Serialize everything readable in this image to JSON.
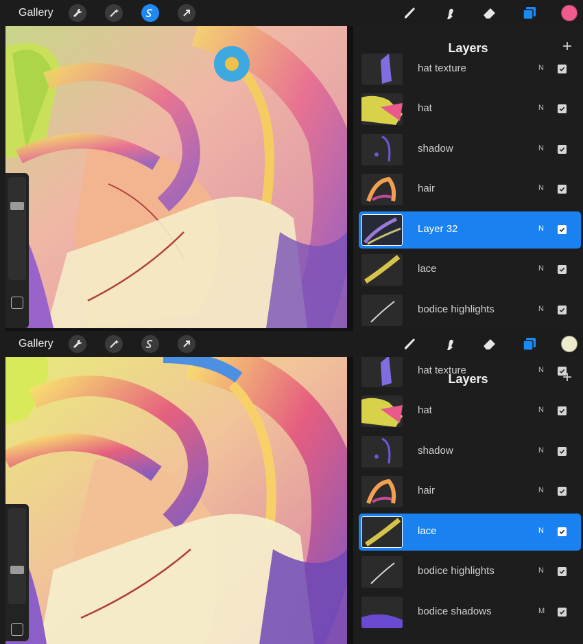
{
  "screens": [
    {
      "toolbar": {
        "gallery_label": "Gallery",
        "active_tool": "smudge",
        "color": "#ef5b8c"
      },
      "panel": {
        "title": "Layers",
        "add_icon": "plus-icon",
        "layers": [
          {
            "name": "hat texture",
            "blend": "N",
            "visible": true,
            "active": false
          },
          {
            "name": "hat",
            "blend": "N",
            "visible": true,
            "active": false
          },
          {
            "name": "shadow",
            "blend": "N",
            "visible": true,
            "active": false
          },
          {
            "name": "hair",
            "blend": "N",
            "visible": true,
            "active": false
          },
          {
            "name": "Layer 32",
            "blend": "N",
            "visible": true,
            "active": true
          },
          {
            "name": "lace",
            "blend": "N",
            "visible": true,
            "active": false
          },
          {
            "name": "bodice highlights",
            "blend": "N",
            "visible": true,
            "active": false
          }
        ]
      }
    },
    {
      "toolbar": {
        "gallery_label": "Gallery",
        "active_tool": "layers",
        "color": "#efeccb"
      },
      "panel": {
        "title": "Layers",
        "add_icon": "plus-icon",
        "layers": [
          {
            "name": "hat texture",
            "blend": "N",
            "visible": true,
            "active": false
          },
          {
            "name": "hat",
            "blend": "N",
            "visible": true,
            "active": false
          },
          {
            "name": "shadow",
            "blend": "N",
            "visible": true,
            "active": false
          },
          {
            "name": "hair",
            "blend": "N",
            "visible": true,
            "active": false
          },
          {
            "name": "lace",
            "blend": "N",
            "visible": true,
            "active": true
          },
          {
            "name": "bodice highlights",
            "blend": "N",
            "visible": true,
            "active": false
          },
          {
            "name": "bodice shadows",
            "blend": "M",
            "visible": true,
            "active": false
          }
        ]
      }
    }
  ],
  "icons": {
    "wrench": "wrench-icon",
    "wand": "magic-wand-icon",
    "smudge": "selection-s-icon",
    "arrow": "transform-arrow-icon",
    "brush": "brush-icon",
    "smudge_tool": "smudge-finger-icon",
    "eraser": "eraser-icon",
    "layers": "layers-icon"
  }
}
